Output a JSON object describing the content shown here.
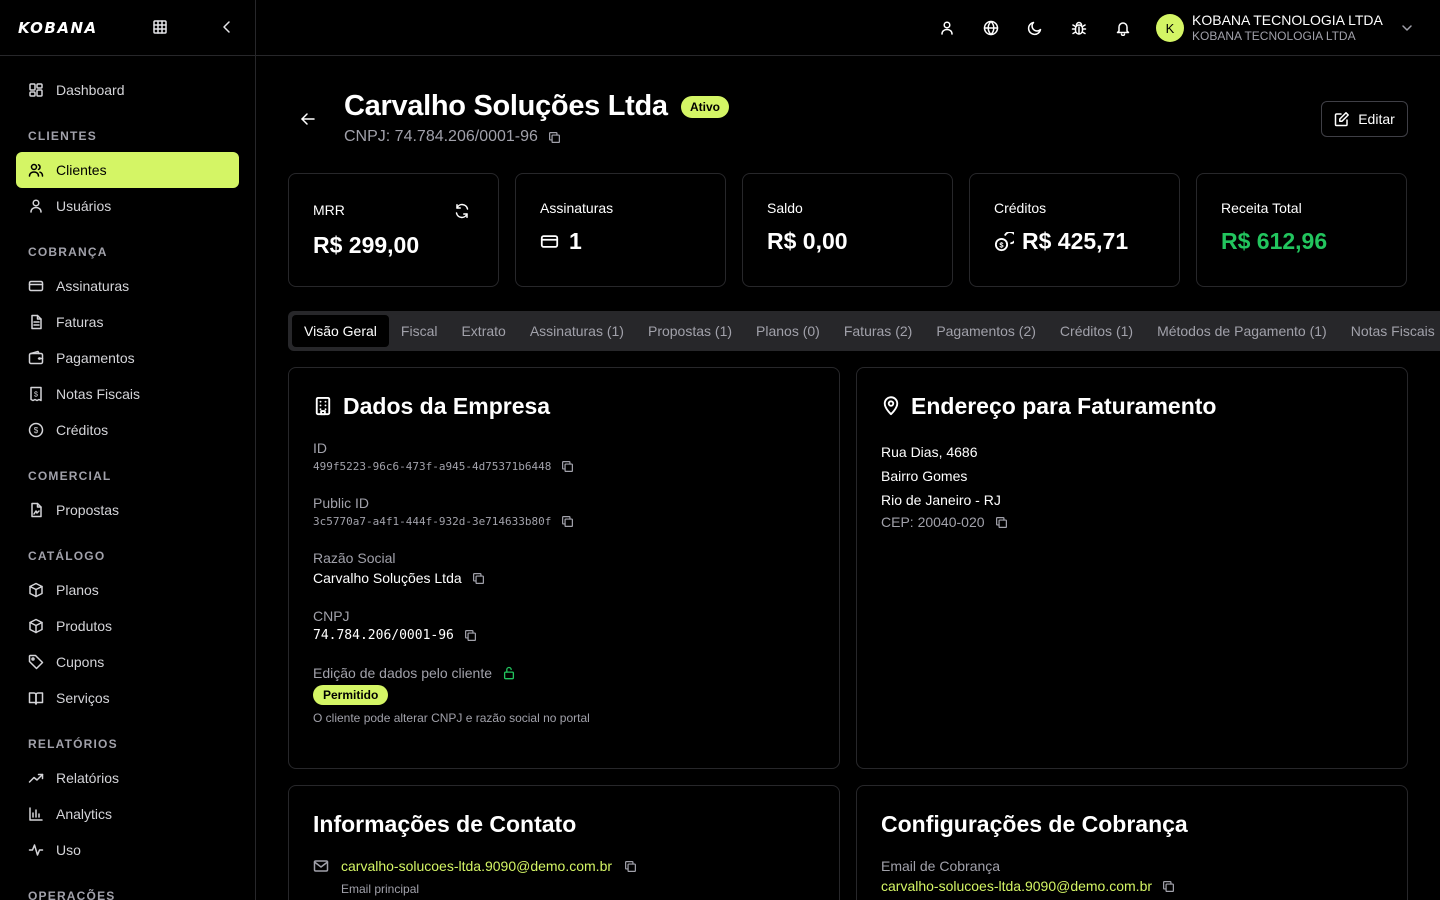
{
  "brand": {
    "logo": "KOBANA"
  },
  "sidebar": {
    "dashboard": "Dashboard",
    "sections": {
      "clientes": "CLIENTES",
      "cobranca": "COBRANÇA",
      "comercial": "COMERCIAL",
      "catalogo": "CATÁLOGO",
      "relatorios": "RELATÓRIOS",
      "operacoes": "OPERAÇÕES"
    },
    "items": {
      "clientes": "Clientes",
      "usuarios": "Usuários",
      "assinaturas": "Assinaturas",
      "faturas": "Faturas",
      "pagamentos": "Pagamentos",
      "notas_fiscais": "Notas Fiscais",
      "creditos": "Créditos",
      "propostas": "Propostas",
      "planos": "Planos",
      "produtos": "Produtos",
      "cupons": "Cupons",
      "servicos": "Serviços",
      "relatorios": "Relatórios",
      "analytics": "Analytics",
      "uso": "Uso"
    }
  },
  "topbar": {
    "avatar_initial": "K",
    "account_name": "KOBANA TECNOLOGIA LTDA",
    "account_sub": "KOBANA TECNOLOGIA LTDA"
  },
  "header": {
    "title": "Carvalho Soluções Ltda",
    "status": "Ativo",
    "cnpj": "CNPJ: 74.784.206/0001-96",
    "edit_label": "Editar"
  },
  "stats": {
    "mrr_label": "MRR",
    "mrr_value": "R$ 299,00",
    "assinaturas_label": "Assinaturas",
    "assinaturas_value": "1",
    "saldo_label": "Saldo",
    "saldo_value": "R$ 0,00",
    "creditos_label": "Créditos",
    "creditos_value": "R$ 425,71",
    "receita_label": "Receita Total",
    "receita_value": "R$ 612,96"
  },
  "tabs": {
    "visao_geral": "Visão Geral",
    "fiscal": "Fiscal",
    "extrato": "Extrato",
    "assinaturas": "Assinaturas (1)",
    "propostas": "Propostas (1)",
    "planos": "Planos (0)",
    "faturas": "Faturas (2)",
    "pagamentos": "Pagamentos (2)",
    "creditos": "Créditos (1)",
    "metodos": "Métodos de Pagamento (1)",
    "notas": "Notas Fiscais"
  },
  "empresa": {
    "title": "Dados da Empresa",
    "id_label": "ID",
    "id_value": "499f5223-96c6-473f-a945-4d75371b6448",
    "public_id_label": "Public ID",
    "public_id_value": "3c5770a7-a4f1-444f-932d-3e714633b80f",
    "razao_label": "Razão Social",
    "razao_value": "Carvalho Soluções Ltda",
    "cnpj_label": "CNPJ",
    "cnpj_value": "74.784.206/0001-96",
    "edicao_label": "Edição de dados pelo cliente",
    "edicao_badge": "Permitido",
    "edicao_desc": "O cliente pode alterar CNPJ e razão social no portal"
  },
  "endereco": {
    "title": "Endereço para Faturamento",
    "rua": "Rua Dias, 4686",
    "bairro": "Bairro Gomes",
    "cidade": "Rio de Janeiro - RJ",
    "cep": "CEP: 20040-020"
  },
  "contato": {
    "title": "Informações de Contato",
    "email": "carvalho-solucoes-ltda.9090@demo.com.br",
    "email_label": "Email principal"
  },
  "cobranca": {
    "title": "Configurações de Cobrança",
    "email_label": "Email de Cobrança",
    "email": "carvalho-solucoes-ltda.9090@demo.com.br"
  }
}
